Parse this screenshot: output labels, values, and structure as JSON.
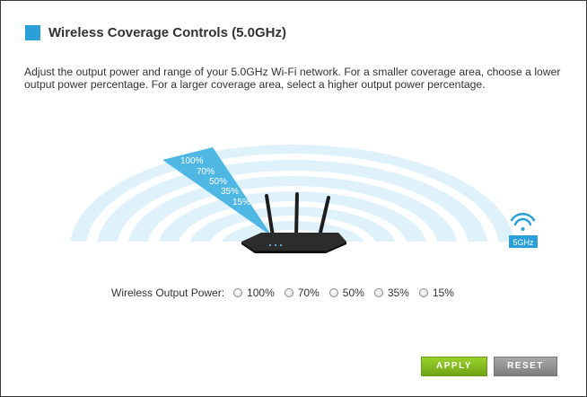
{
  "header": {
    "title": "Wireless Coverage Controls (5.0GHz)"
  },
  "description": "Adjust the output power and range of your 5.0GHz Wi-Fi network. For a smaller coverage area, choose a lower output power percentage. For a larger coverage area, select a higher output power percentage.",
  "illustration": {
    "percent_labels": [
      "100%",
      "70%",
      "50%",
      "35%",
      "15%"
    ],
    "band_badge": "5GHz",
    "wifi_icon": "wifi-icon",
    "router_icon": "router-icon"
  },
  "power": {
    "label": "Wireless Output Power:",
    "options": [
      "100%",
      "70%",
      "50%",
      "35%",
      "15%"
    ],
    "selected": null
  },
  "buttons": {
    "apply": "APPLY",
    "reset": "RESET"
  },
  "colors": {
    "accent": "#2a9fd8",
    "apply": "#86bd22",
    "reset": "#8e8e8e",
    "wedge": "#4fb7e4",
    "wave": "#dff2fb"
  }
}
